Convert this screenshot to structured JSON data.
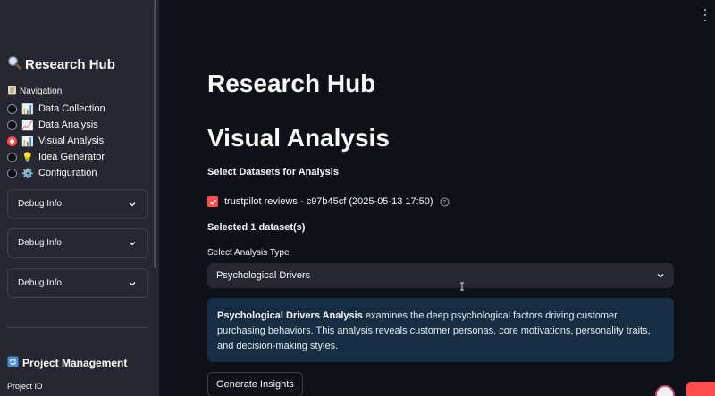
{
  "sidebar": {
    "title": "Research Hub",
    "title_icon": "magnifier-icon",
    "nav_label": "Navigation",
    "nav_items": [
      {
        "label": "Data Collection",
        "icon": "📊",
        "checked": false
      },
      {
        "label": "Data Analysis",
        "icon": "📈",
        "checked": false
      },
      {
        "label": "Visual Analysis",
        "icon": "📊",
        "checked": true
      },
      {
        "label": "Idea Generator",
        "icon": "💡",
        "checked": false
      },
      {
        "label": "Configuration",
        "icon": "⚙️",
        "checked": false
      }
    ],
    "debug_sections": [
      "Debug Info",
      "Debug Info",
      "Debug Info"
    ],
    "project_management": "Project Management",
    "project_id_label": "Project ID"
  },
  "main": {
    "title": "Research Hub",
    "subtitle": "Visual Analysis",
    "select_datasets_label": "Select Datasets for Analysis",
    "dataset": {
      "label": "trustpilot reviews - c97b45cf (2025-05-13 17:50)",
      "checked": true
    },
    "selected_count": "Selected 1 dataset(s)",
    "analysis_type_label": "Select Analysis Type",
    "analysis_type_value": "Psychological Drivers",
    "info_bold": "Psychological Drivers Analysis",
    "info_text": " examines the deep psychological factors driving customer purchasing behaviors. This analysis reveals customer personas, core motivations, personality traits, and decision-making styles.",
    "generate_button": "Generate Insights"
  },
  "colors": {
    "background": "#0e1117",
    "sidebar": "#262730",
    "accent": "#ff4b4b",
    "info_bg": "#172d43"
  }
}
